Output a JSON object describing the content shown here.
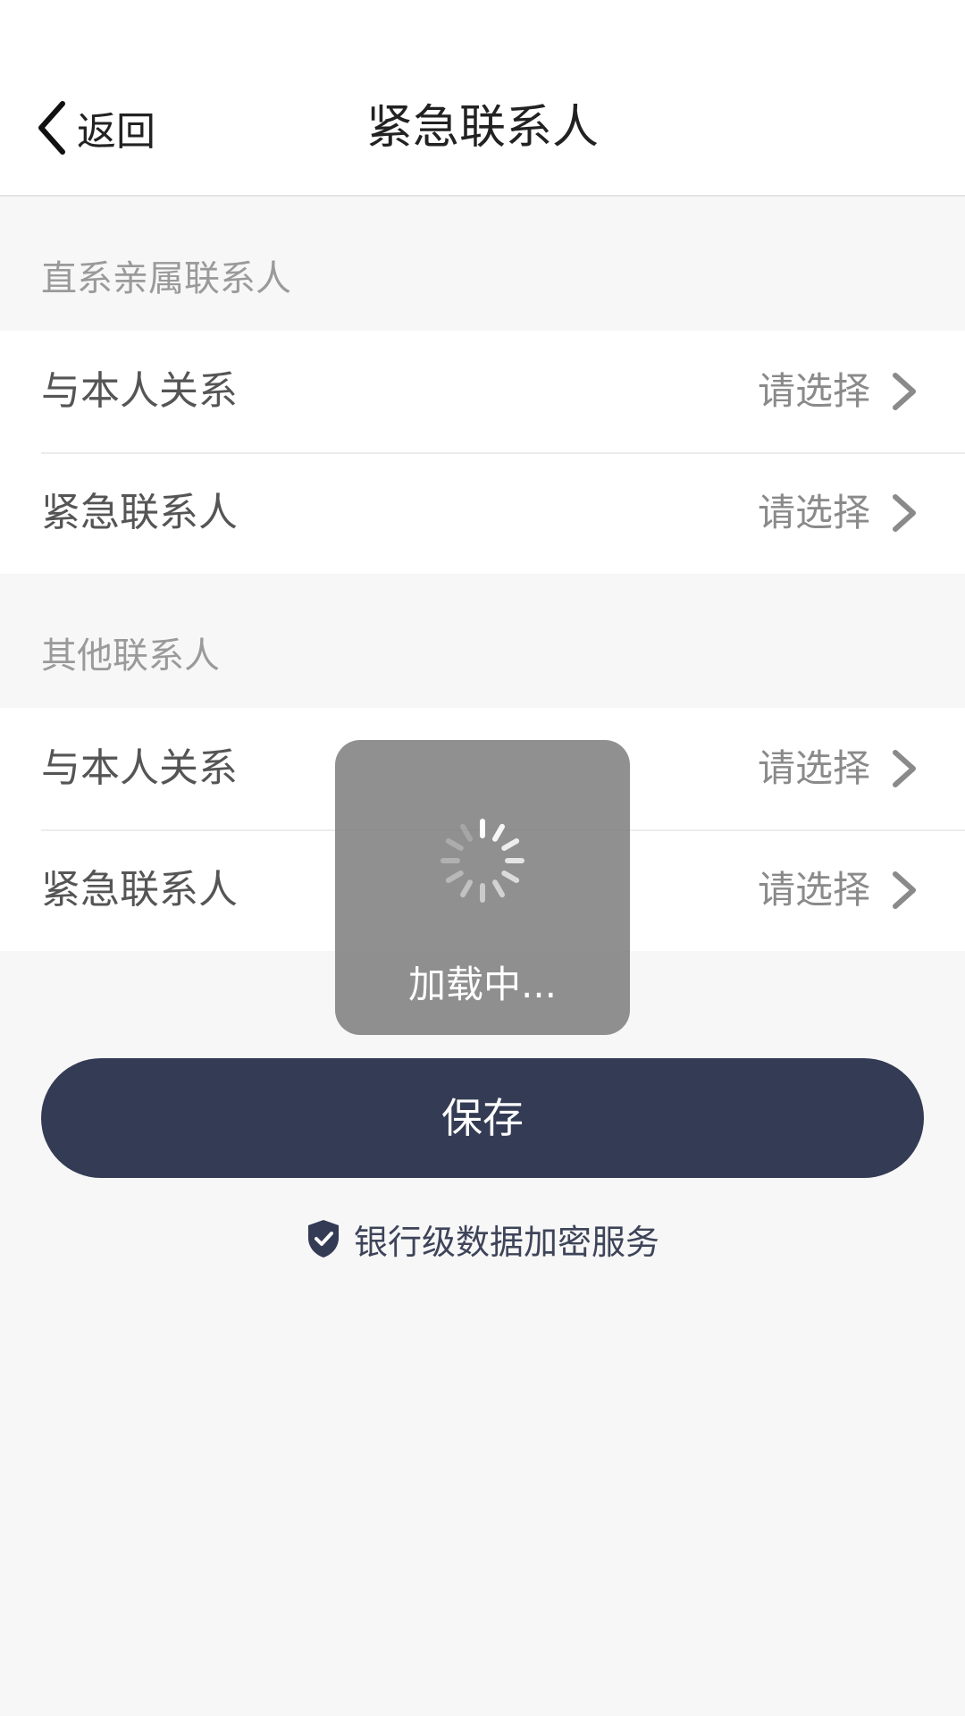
{
  "header": {
    "back_label": "返回",
    "title": "紧急联系人"
  },
  "sections": [
    {
      "title": "直系亲属联系人",
      "rows": [
        {
          "label": "与本人关系",
          "value": "请选择"
        },
        {
          "label": "紧急联系人",
          "value": "请选择"
        }
      ]
    },
    {
      "title": "其他联系人",
      "rows": [
        {
          "label": "与本人关系",
          "value": "请选择"
        },
        {
          "label": "紧急联系人",
          "value": "请选择"
        }
      ]
    }
  ],
  "save_button": {
    "label": "保存"
  },
  "security_note": {
    "text": "银行级数据加密服务",
    "icon": "shield-check-icon"
  },
  "loading_toast": {
    "text": "加载中..."
  },
  "colors": {
    "primary": "#343b54",
    "background": "#f7f7f7",
    "muted_text": "#9a9a9a"
  }
}
